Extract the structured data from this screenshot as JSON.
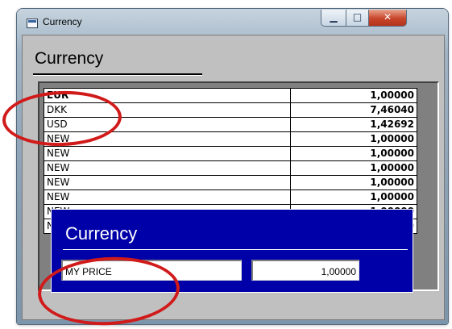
{
  "window": {
    "title": "Currency",
    "controls": {
      "minimize": "▁",
      "maximize": "□",
      "close": "✕"
    }
  },
  "main": {
    "heading": "Currency",
    "rows": [
      {
        "code": "EUR",
        "rate": "1,00000"
      },
      {
        "code": "DKK",
        "rate": "7,46040"
      },
      {
        "code": "USD",
        "rate": "1,42692"
      },
      {
        "code": "NEW",
        "rate": "1,00000"
      },
      {
        "code": "NEW",
        "rate": "1,00000"
      },
      {
        "code": "NEW",
        "rate": "1,00000"
      },
      {
        "code": "NEW",
        "rate": "1,00000"
      },
      {
        "code": "NEW",
        "rate": "1,00000"
      },
      {
        "code": "NEW",
        "rate": "1,00000"
      },
      {
        "code": "NEW",
        "rate": "1,00000"
      }
    ]
  },
  "dialog": {
    "title": "Currency",
    "name_value": "MY PRICE",
    "rate_value": "1,00000"
  },
  "colors": {
    "dialog_bg": "#0000a8",
    "annotation": "#d11a1a",
    "client_bg": "#c0c0c0"
  }
}
